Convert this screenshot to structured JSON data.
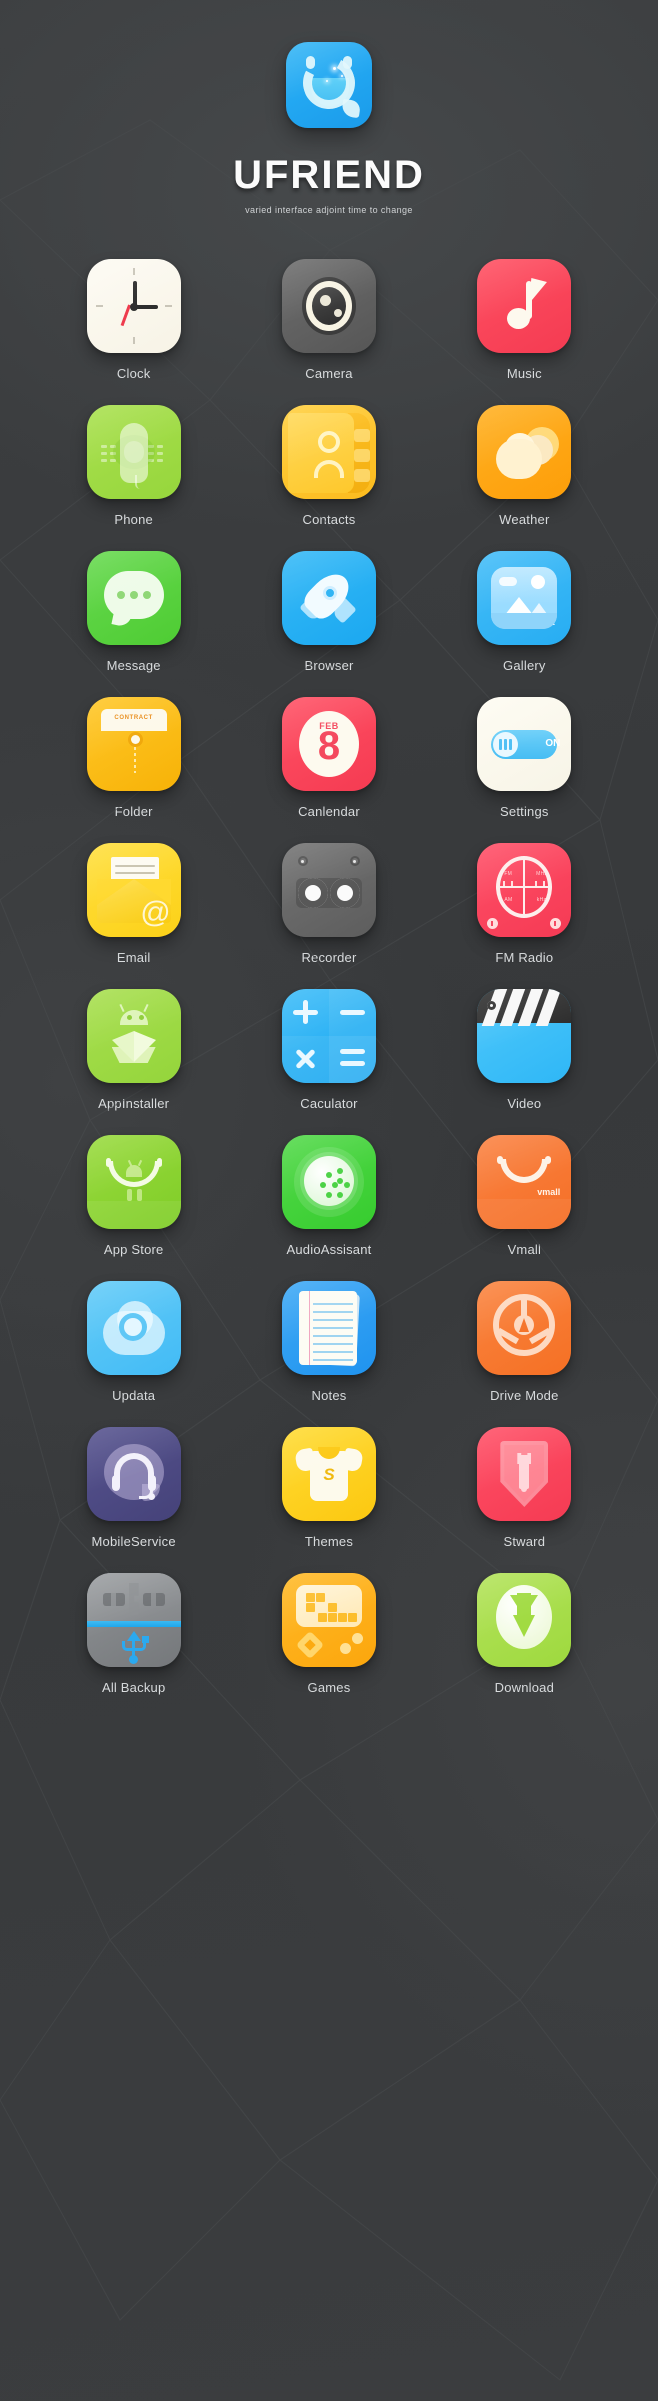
{
  "header": {
    "logo_icon": "ufriend-logo-icon",
    "brand": "UFRIEND",
    "tagline": "varied interface adjoint time to change"
  },
  "colors": {
    "background": "#3a3c3e",
    "label_text": "#dcdfe1",
    "brand_text": "#fbfbfb"
  },
  "apps": [
    {
      "label": "Clock",
      "icon": "clock-icon",
      "color": "#fdfbf3"
    },
    {
      "label": "Camera",
      "icon": "camera-icon",
      "color": "#6d6d6d"
    },
    {
      "label": "Music",
      "icon": "music-note-icon",
      "color": "#ff4f61"
    },
    {
      "label": "Phone",
      "icon": "phone-handset-icon",
      "color": "#a9e04e"
    },
    {
      "label": "Contacts",
      "icon": "contacts-book-icon",
      "color": "#ffcf3e"
    },
    {
      "label": "Weather",
      "icon": "weather-cloud-sun-icon",
      "color": "#ffb021"
    },
    {
      "label": "Message",
      "icon": "chat-bubble-icon",
      "color": "#67d94f"
    },
    {
      "label": "Browser",
      "icon": "rocket-icon",
      "color": "#35b9f7"
    },
    {
      "label": "Gallery",
      "icon": "mountain-photo-icon",
      "color": "#44bdf8"
    },
    {
      "label": "Folder",
      "icon": "envelope-folder-icon",
      "color": "#ffc727",
      "badge": "CONTRACT"
    },
    {
      "label": "Canlendar",
      "icon": "calendar-icon",
      "color": "#ff5064",
      "month": "FEB",
      "day": "8"
    },
    {
      "label": "Settings",
      "icon": "toggle-switch-icon",
      "color": "#fefcf2",
      "toggle": "ON"
    },
    {
      "label": "Email",
      "icon": "envelope-at-icon",
      "color": "#ffdf3d",
      "at": "@"
    },
    {
      "label": "Recorder",
      "icon": "tape-recorder-icon",
      "color": "#737373"
    },
    {
      "label": "FM Radio",
      "icon": "radio-dial-icon",
      "color": "#ff4f67",
      "dial_labels": [
        "FM",
        "MHz",
        "AM",
        "kHz"
      ]
    },
    {
      "label": "AppInstaller",
      "icon": "android-box-icon",
      "color": "#a8df4f"
    },
    {
      "label": "Caculator",
      "icon": "calculator-icon",
      "color": "#3cbcf8"
    },
    {
      "label": "Video",
      "icon": "clapperboard-icon",
      "color": "#4ec8fb"
    },
    {
      "label": "App Store",
      "icon": "shopping-bag-android-icon",
      "color": "#99da3e"
    },
    {
      "label": "AudioAssisant",
      "icon": "speaker-disc-icon",
      "color": "#53d94a"
    },
    {
      "label": "Vmall",
      "icon": "shopping-bag-icon",
      "color": "#fa8242",
      "badge": "vmall"
    },
    {
      "label": "Updata",
      "icon": "cloud-sync-icon",
      "color": "#63cbf8"
    },
    {
      "label": "Notes",
      "icon": "lined-paper-icon",
      "color": "#3fa9f5"
    },
    {
      "label": "Drive Mode",
      "icon": "steering-wheel-icon",
      "color": "#fa8440"
    },
    {
      "label": "MobileService",
      "icon": "headset-bubble-icon",
      "color": "#56538f"
    },
    {
      "label": "Themes",
      "icon": "tshirt-icon",
      "color": "#ffdb33",
      "badge": "S"
    },
    {
      "label": "Stward",
      "icon": "shield-wrench-icon",
      "color": "#ff4f66"
    },
    {
      "label": "All Backup",
      "icon": "usb-backup-icon",
      "color": "#8f9295"
    },
    {
      "label": "Games",
      "icon": "handheld-console-icon",
      "color": "#ffba28"
    },
    {
      "label": "Download",
      "icon": "download-arrow-icon",
      "color": "#b3e35a"
    }
  ]
}
